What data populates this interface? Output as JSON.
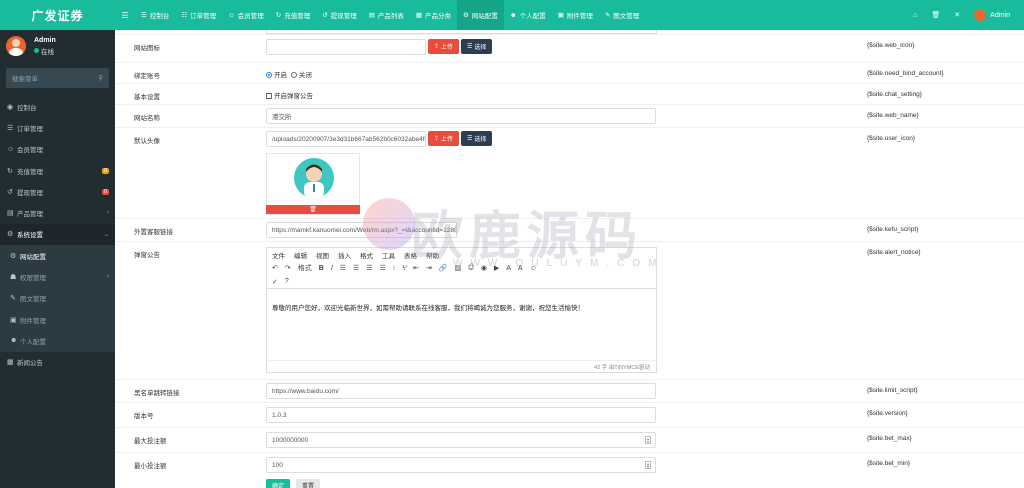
{
  "app": {
    "logo_text": "广发证券"
  },
  "user": {
    "name": "Admin",
    "status": "在线"
  },
  "sidebar": {
    "search_placeholder": "搜索菜单",
    "items": [
      {
        "label": "控制台",
        "icon": "dashboard-icon"
      },
      {
        "label": "订单管理",
        "icon": "list-icon"
      },
      {
        "label": "会员管理",
        "icon": "users-icon"
      },
      {
        "label": "充值管理",
        "icon": "recharge-icon",
        "badge": "0"
      },
      {
        "label": "提现管理",
        "icon": "withdraw-icon",
        "badge": "0"
      },
      {
        "label": "产品管理",
        "icon": "product-icon"
      },
      {
        "label": "系统设置",
        "icon": "gear-icon"
      },
      {
        "label": "网站配置",
        "icon": "gear-icon"
      },
      {
        "label": "权限管理",
        "icon": "group-icon"
      },
      {
        "label": "图文管理",
        "icon": "article-icon"
      },
      {
        "label": "附件管理",
        "icon": "file-icon"
      },
      {
        "label": "个人配置",
        "icon": "user-icon"
      },
      {
        "label": "新闻公告",
        "icon": "news-icon"
      }
    ]
  },
  "topnav": {
    "tabs": [
      {
        "label": "控制台",
        "icon": "☰"
      },
      {
        "label": "订单管理",
        "icon": "☷"
      },
      {
        "label": "会员管理",
        "icon": "☺"
      },
      {
        "label": "充值管理",
        "icon": "↻"
      },
      {
        "label": "提现管理",
        "icon": "↺"
      },
      {
        "label": "产品列表",
        "icon": "▤"
      },
      {
        "label": "产品分类",
        "icon": "▦"
      },
      {
        "label": "网站配置",
        "icon": "⚙"
      },
      {
        "label": "个人配置",
        "icon": "☻"
      },
      {
        "label": "附件管理",
        "icon": "▣"
      },
      {
        "label": "图文管理",
        "icon": "✎"
      }
    ],
    "user_name": "Admin"
  },
  "form": {
    "icon_row": {
      "label": "网站图标",
      "value": "",
      "var": "{$site.web_icon}"
    },
    "bind_row": {
      "label": "绑定账号",
      "opt_on": "开启",
      "opt_off": "关闭",
      "var": "{$site.need_bind_account}"
    },
    "basic_row": {
      "label": "基本设置",
      "check_label": "开启弹窗公告",
      "var": "{$site.chat_setting}"
    },
    "name_row": {
      "label": "网站名称",
      "value": "港交所",
      "var": "{$site.web_name}"
    },
    "avatar_row": {
      "label": "默认头像",
      "value": "/uploads/20200907/3e3d31b667ab562b0c6032abe4f0",
      "var": "{$site.user_icon}"
    },
    "kefu_row": {
      "label": "外置客服链接",
      "value": "https://mamkf.kanuomei.com/Web/im.aspx?_=t&accountid=128092",
      "var": "{$site.kefu_script}"
    },
    "notice_row": {
      "label": "弹窗公告",
      "var": "{$site.alert_notice}"
    },
    "limit_row": {
      "label": "黑名单跳转链接",
      "value": "https://www.baidu.com/",
      "var": "{$site.limit_script}"
    },
    "version_row": {
      "label": "版本号",
      "value": "1.0.3",
      "var": "{$site.version}"
    },
    "betmax_row": {
      "label": "最大投注额",
      "value": "1000000000",
      "var": "{$site.bet_max}"
    },
    "betmin_row": {
      "label": "最小投注额",
      "value": "100",
      "var": "{$site.bet_min}"
    },
    "upload_label": "上传",
    "select_label": "选择",
    "submit_label": "确定",
    "reset_label": "重置"
  },
  "editor": {
    "menus": [
      "文件",
      "编辑",
      "视图",
      "插入",
      "格式",
      "工具",
      "表格",
      "帮助"
    ],
    "format_label": "格式",
    "content": "尊敬的用户您好，欢迎光临新世界，如需帮助请联系在线客服，我们将竭诚为您服务，谢谢，祝您生活愉快！",
    "status": "42 字 由TINYMCE驱动"
  },
  "watermark": {
    "text": "欧鹿源码",
    "sub": "WWW.OULUYM.COM"
  },
  "colors": {
    "brand": "#18bc9c",
    "sidebar": "#222d32",
    "danger": "#e74c3c",
    "dark_button": "#2c3e50"
  }
}
